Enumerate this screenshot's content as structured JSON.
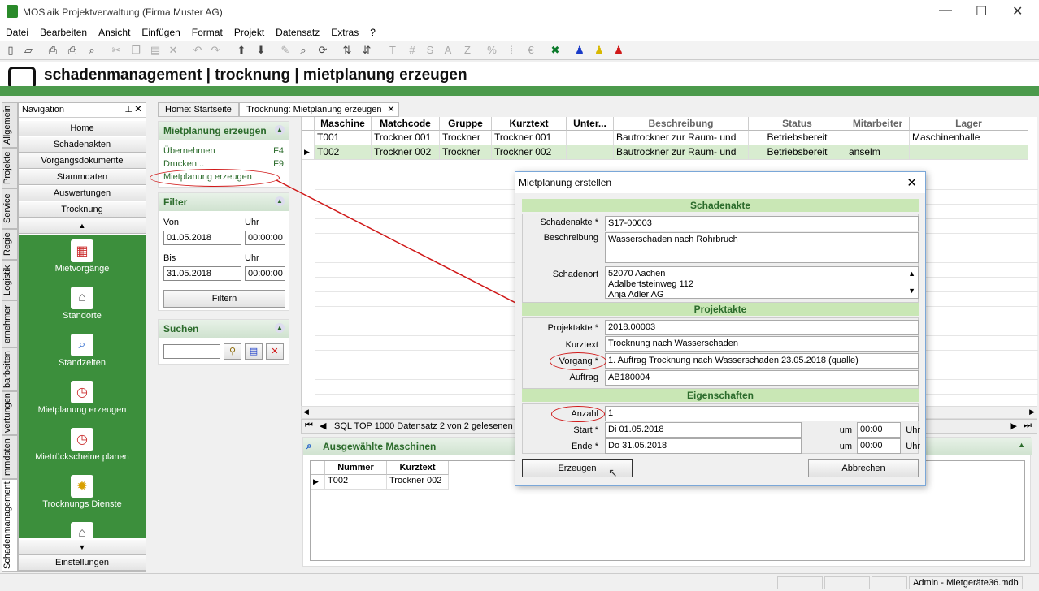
{
  "window": {
    "title": "MOS'aik Projektverwaltung (Firma Muster AG)",
    "minimize": "—",
    "maximize": "☐",
    "close": "✕"
  },
  "menu": [
    "Datei",
    "Bearbeiten",
    "Ansicht",
    "Einfügen",
    "Format",
    "Projekt",
    "Datensatz",
    "Extras",
    "?"
  ],
  "header": {
    "title": "schadenmanagement | trocknung | mietplanung erzeugen"
  },
  "nav": {
    "title": "Navigation",
    "vtabs": [
      "Allgemein",
      "Projekte",
      "Service",
      "Regie",
      "Logistik",
      "ernehmer",
      "barbeiten",
      "vertungen",
      "mmdaten",
      "Schadenmanagement"
    ],
    "buttons": [
      "Home",
      "Schadenakten",
      "Vorgangsdokumente",
      "Stammdaten",
      "Auswertungen",
      "Trocknung"
    ],
    "items": [
      "Mietvorgänge",
      "Standorte",
      "Standzeiten",
      "Mietplanung erzeugen",
      "Mietrückscheine planen",
      "Trocknungs Dienste"
    ],
    "settings": "Einstellungen"
  },
  "tabs": [
    "Home: Startseite",
    "Trocknung: Mietplanung erzeugen"
  ],
  "actions": {
    "title": "Mietplanung erzeugen",
    "items": [
      {
        "label": "Übernehmen",
        "key": "F4"
      },
      {
        "label": "Drucken...",
        "key": "F9"
      },
      {
        "label": "Mietplanung erzeugen",
        "key": ""
      }
    ]
  },
  "filter": {
    "title": "Filter",
    "von_label": "Von",
    "uhr_label": "Uhr",
    "von": "01.05.2018",
    "von_time": "00:00:00",
    "bis_label": "Bis",
    "bis": "31.05.2018",
    "bis_time": "00:00:00",
    "button": "Filtern"
  },
  "search": {
    "title": "Suchen",
    "value": ""
  },
  "grid": {
    "columns": [
      "Maschine",
      "Matchcode",
      "Gruppe",
      "Kurztext",
      "Unter...",
      "Beschreibung",
      "Status",
      "Mitarbeiter",
      "Lager"
    ],
    "rows": [
      [
        "T001",
        "Trockner 001",
        "Trockner",
        "Trockner 001",
        "",
        "Bautrockner zur Raum- und",
        "Betriebsbereit",
        "",
        "Maschinenhalle"
      ],
      [
        "T002",
        "Trockner 002",
        "Trockner",
        "Trockner 002",
        "",
        "Bautrockner zur Raum- und",
        "Betriebsbereit",
        "anselm",
        ""
      ]
    ],
    "status": "SQL TOP 1000 Datensatz 2 von 2 gelesenen -"
  },
  "selected": {
    "title": "Ausgewählte Maschinen",
    "columns": [
      "Nummer",
      "Kurztext"
    ],
    "rows": [
      [
        "T002",
        "Trockner 002"
      ]
    ]
  },
  "statusbar": {
    "user": "Admin - Mietgeräte36.mdb"
  },
  "dialog": {
    "title": "Mietplanung erstellen",
    "sec1": "Schadenakte",
    "schadenakte_label": "Schadenakte *",
    "schadenakte": "S17-00003",
    "beschreibung_label": "Beschreibung",
    "beschreibung": "Wasserschaden nach Rohrbruch",
    "schadenort_label": "Schadenort",
    "schadenort": [
      "52070 Aachen",
      "Adalbertsteinweg 112",
      "Anja Adler AG"
    ],
    "sec2": "Projektakte",
    "projektakte_label": "Projektakte *",
    "projektakte": "2018.00003",
    "kurztext_label": "Kurztext",
    "kurztext": "Trocknung nach Wasserschaden",
    "vorgang_label": "Vorgang *",
    "vorgang": "1. Auftrag Trocknung nach Wasserschaden 23.05.2018 (qualle)",
    "auftrag_label": "Auftrag",
    "auftrag": "AB180004",
    "sec3": "Eigenschaften",
    "anzahl_label": "Anzahl",
    "anzahl": "1",
    "start_label": "Start *",
    "start": "Di 01.05.2018",
    "start_um": "um",
    "start_time": "00:00",
    "start_uhr": "Uhr",
    "ende_label": "Ende *",
    "ende": "Do 31.05.2018",
    "ende_um": "um",
    "ende_time": "00:00",
    "ende_uhr": "Uhr",
    "erzeugen": "Erzeugen",
    "abbrechen": "Abbrechen"
  },
  "colors": {
    "accent_green": "#3c8f3c",
    "header_green": "#4c9a4c",
    "annotation_red": "#d01818"
  }
}
